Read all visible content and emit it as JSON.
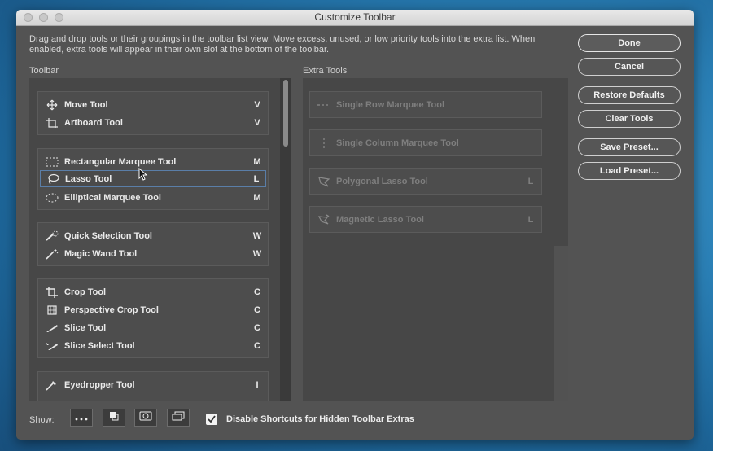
{
  "window": {
    "title": "Customize Toolbar"
  },
  "instructions": "Drag and drop tools or their groupings in the toolbar list view. Move excess, unused, or low priority tools into the extra list. When enabled, extra tools will appear in their own slot at the bottom of the toolbar.",
  "toolbar_label": "Toolbar",
  "extra_label": "Extra Tools",
  "toolbar_groups": [
    {
      "items": [
        {
          "label": "Move Tool",
          "key": "V",
          "icon": "move-icon"
        },
        {
          "label": "Artboard Tool",
          "key": "V",
          "icon": "artboard-icon"
        }
      ]
    },
    {
      "items": [
        {
          "label": "Rectangular Marquee Tool",
          "key": "M",
          "icon": "rect-marquee-icon"
        },
        {
          "label": "Lasso Tool",
          "key": "L",
          "icon": "lasso-icon",
          "selected": true
        },
        {
          "label": "Elliptical Marquee Tool",
          "key": "M",
          "icon": "ellipse-marquee-icon"
        }
      ]
    },
    {
      "items": [
        {
          "label": "Quick Selection Tool",
          "key": "W",
          "icon": "quick-selection-icon"
        },
        {
          "label": "Magic Wand Tool",
          "key": "W",
          "icon": "magic-wand-icon"
        }
      ]
    },
    {
      "items": [
        {
          "label": "Crop Tool",
          "key": "C",
          "icon": "crop-icon"
        },
        {
          "label": "Perspective Crop Tool",
          "key": "C",
          "icon": "perspective-crop-icon"
        },
        {
          "label": "Slice Tool",
          "key": "C",
          "icon": "slice-icon"
        },
        {
          "label": "Slice Select Tool",
          "key": "C",
          "icon": "slice-select-icon"
        }
      ]
    },
    {
      "items": [
        {
          "label": "Eyedropper Tool",
          "key": "I",
          "icon": "eyedropper-icon"
        }
      ]
    }
  ],
  "extra_tools": [
    {
      "label": "Single Row Marquee Tool",
      "key": "",
      "icon": "single-row-marquee-icon"
    },
    {
      "label": "Single Column Marquee Tool",
      "key": "",
      "icon": "single-column-marquee-icon"
    },
    {
      "label": "Polygonal Lasso Tool",
      "key": "L",
      "icon": "polygonal-lasso-icon"
    },
    {
      "label": "Magnetic Lasso Tool",
      "key": "L",
      "icon": "magnetic-lasso-icon"
    }
  ],
  "buttons": {
    "done": "Done",
    "cancel": "Cancel",
    "restore_defaults": "Restore Defaults",
    "clear_tools": "Clear Tools",
    "save_preset": "Save Preset...",
    "load_preset": "Load Preset..."
  },
  "bottom": {
    "show_label": "Show:",
    "show_buttons": [
      "more-tools-icon",
      "foreground-background-icon",
      "quick-mask-icon",
      "screen-mode-icon"
    ],
    "disable_shortcuts_label": "Disable Shortcuts for Hidden Toolbar Extras",
    "disable_shortcuts_checked": true
  }
}
